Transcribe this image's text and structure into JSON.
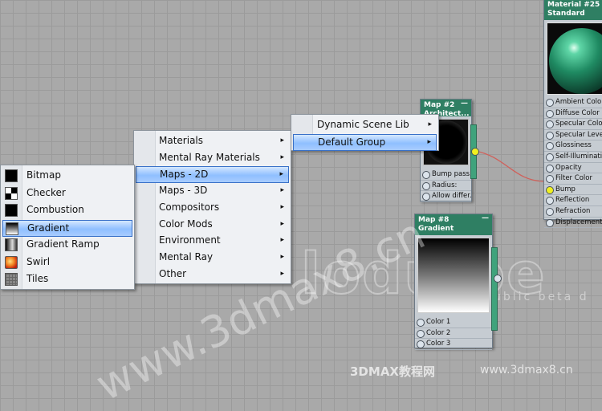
{
  "material_node": {
    "title": "Material #25",
    "subtitle": "Standard",
    "slots": [
      "Ambient Color",
      "Diffuse Color",
      "Specular Color",
      "Specular Level",
      "Glossiness",
      "Self-Illumination",
      "Opacity",
      "Filter Color",
      "Bump",
      "Reflection",
      "Refraction",
      "Displacement"
    ]
  },
  "map2_node": {
    "title": "Map #2",
    "subtitle": "Architect...",
    "dash": "—",
    "slots": [
      "Bump pass...",
      "Radius:",
      "Allow differ..."
    ]
  },
  "map8_node": {
    "title": "Map #8",
    "subtitle": "Gradient",
    "dash": "—",
    "slots": [
      "Color 1",
      "Color 2",
      "Color 3"
    ]
  },
  "menu_main": {
    "items": [
      {
        "label": "Materials",
        "arrow": "▸"
      },
      {
        "label": "Mental Ray Materials",
        "arrow": "▸"
      },
      {
        "label": "Maps - 2D",
        "arrow": "▸"
      },
      {
        "label": "Maps - 3D",
        "arrow": "▸"
      },
      {
        "label": "Compositors",
        "arrow": "▸"
      },
      {
        "label": "Color Mods",
        "arrow": "▸"
      },
      {
        "label": "Environment",
        "arrow": "▸"
      },
      {
        "label": "Mental Ray",
        "arrow": "▸"
      },
      {
        "label": "Other",
        "arrow": "▸"
      }
    ],
    "selected": "Maps - 2D"
  },
  "menu_group": {
    "items": [
      {
        "label": "Dynamic Scene Lib",
        "arrow": "▸"
      },
      {
        "label": "Default Group",
        "arrow": "▸"
      }
    ],
    "selected": "Default Group"
  },
  "menu_maps2d": {
    "items": [
      {
        "label": "Bitmap",
        "icon": "bitmap-icon"
      },
      {
        "label": "Checker",
        "icon": "checker-icon"
      },
      {
        "label": "Combustion",
        "icon": "combustion-icon"
      },
      {
        "label": "Gradient",
        "icon": "gradient-icon"
      },
      {
        "label": "Gradient Ramp",
        "icon": "gradient-ramp-icon"
      },
      {
        "label": "Swirl",
        "icon": "swirl-icon"
      },
      {
        "label": "Tiles",
        "icon": "tiles-icon"
      }
    ],
    "selected": "Gradient"
  },
  "watermark": {
    "logo_text": "lodujoe",
    "sub_text": "ublic beta d",
    "url": "www.3dmax8.cn",
    "bottom_left": "3DMAX教程网",
    "bottom_right": "www.3dmax8.cn"
  },
  "colors": {
    "node_header": "#2f7f63",
    "connection_wire": "#d0605a",
    "selection": "#8fbfff"
  }
}
